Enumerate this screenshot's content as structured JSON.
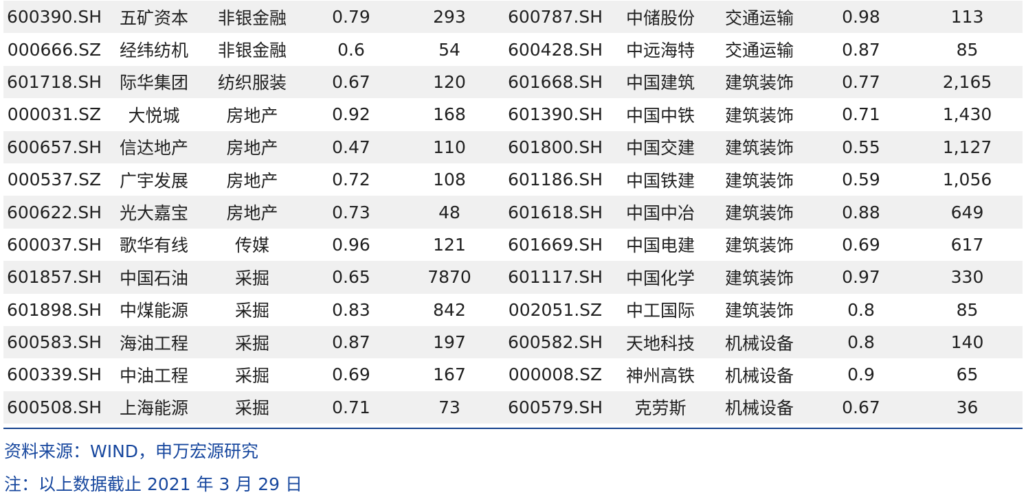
{
  "table": {
    "rows": [
      [
        "600390.SH",
        "五矿资本",
        "非银金融",
        "0.79",
        "293",
        "600787.SH",
        "中储股份",
        "交通运输",
        "0.98",
        "113"
      ],
      [
        "000666.SZ",
        "经纬纺机",
        "非银金融",
        "0.6",
        "54",
        "600428.SH",
        "中远海特",
        "交通运输",
        "0.87",
        "85"
      ],
      [
        "601718.SH",
        "际华集团",
        "纺织服装",
        "0.67",
        "120",
        "601668.SH",
        "中国建筑",
        "建筑装饰",
        "0.77",
        "2,165"
      ],
      [
        "000031.SZ",
        "大悦城",
        "房地产",
        "0.92",
        "168",
        "601390.SH",
        "中国中铁",
        "建筑装饰",
        "0.71",
        "1,430"
      ],
      [
        "600657.SH",
        "信达地产",
        "房地产",
        "0.47",
        "110",
        "601800.SH",
        "中国交建",
        "建筑装饰",
        "0.55",
        "1,127"
      ],
      [
        "000537.SZ",
        "广宇发展",
        "房地产",
        "0.72",
        "108",
        "601186.SH",
        "中国铁建",
        "建筑装饰",
        "0.59",
        "1,056"
      ],
      [
        "600622.SH",
        "光大嘉宝",
        "房地产",
        "0.73",
        "48",
        "601618.SH",
        "中国中冶",
        "建筑装饰",
        "0.88",
        "649"
      ],
      [
        "600037.SH",
        "歌华有线",
        "传媒",
        "0.96",
        "121",
        "601669.SH",
        "中国电建",
        "建筑装饰",
        "0.69",
        "617"
      ],
      [
        "601857.SH",
        "中国石油",
        "采掘",
        "0.65",
        "7870",
        "601117.SH",
        "中国化学",
        "建筑装饰",
        "0.97",
        "330"
      ],
      [
        "601898.SH",
        "中煤能源",
        "采掘",
        "0.83",
        "842",
        "002051.SZ",
        "中工国际",
        "建筑装饰",
        "0.8",
        "85"
      ],
      [
        "600583.SH",
        "海油工程",
        "采掘",
        "0.87",
        "197",
        "600582.SH",
        "天地科技",
        "机械设备",
        "0.8",
        "140"
      ],
      [
        "600339.SH",
        "中油工程",
        "采掘",
        "0.69",
        "167",
        "000008.SZ",
        "神州高铁",
        "机械设备",
        "0.9",
        "65"
      ],
      [
        "600508.SH",
        "上海能源",
        "采掘",
        "0.71",
        "73",
        "600579.SH",
        "克劳斯",
        "机械设备",
        "0.67",
        "36"
      ]
    ]
  },
  "footer": {
    "source": "资料来源：WIND，申万宏源研究",
    "note": "注：以上数据截止 2021 年 3 月 29 日"
  },
  "colors": {
    "row_shade": "#f0f0f0",
    "rule": "#123f8c",
    "note_text": "#17479e"
  }
}
